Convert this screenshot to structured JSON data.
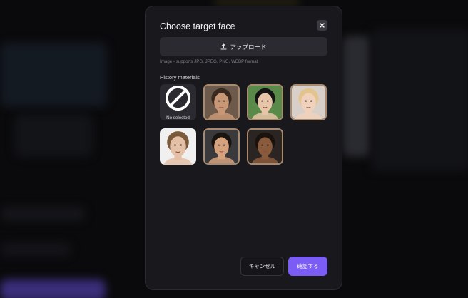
{
  "modal": {
    "title": "Choose target face",
    "close_icon": "close-icon",
    "upload_label": "アップロード",
    "upload_icon": "upload-icon",
    "hint": "Image - supports JPG, JPEG, PNG, WEBP format",
    "section_label": "History materials",
    "none_label": "No selected",
    "none_icon": "ban-icon",
    "faces": [
      {
        "name": "man-dark-hair",
        "skin": "#c89876",
        "hair": "#3a2a20",
        "bg": "#6e5a4a"
      },
      {
        "name": "man-black-hair-suit",
        "skin": "#e8c4a8",
        "hair": "#151515",
        "bg": "#5a8a4a"
      },
      {
        "name": "woman-blonde",
        "skin": "#f0d2bc",
        "hair": "#e4c48e",
        "bg": "#d8d0c8"
      },
      {
        "name": "man-light-hair",
        "skin": "#e4c0a6",
        "hair": "#7a5a3a",
        "bg": "#f0f0f0"
      },
      {
        "name": "woman-dark-hair",
        "skin": "#d6a27e",
        "hair": "#1a1410",
        "bg": "#3a3a3c"
      },
      {
        "name": "woman-curly-hair",
        "skin": "#8a5a3c",
        "hair": "#1a120c",
        "bg": "#2a2422"
      }
    ],
    "cancel_label": "キャンセル",
    "confirm_label": "確認する",
    "accent": "#7b5cf5"
  }
}
